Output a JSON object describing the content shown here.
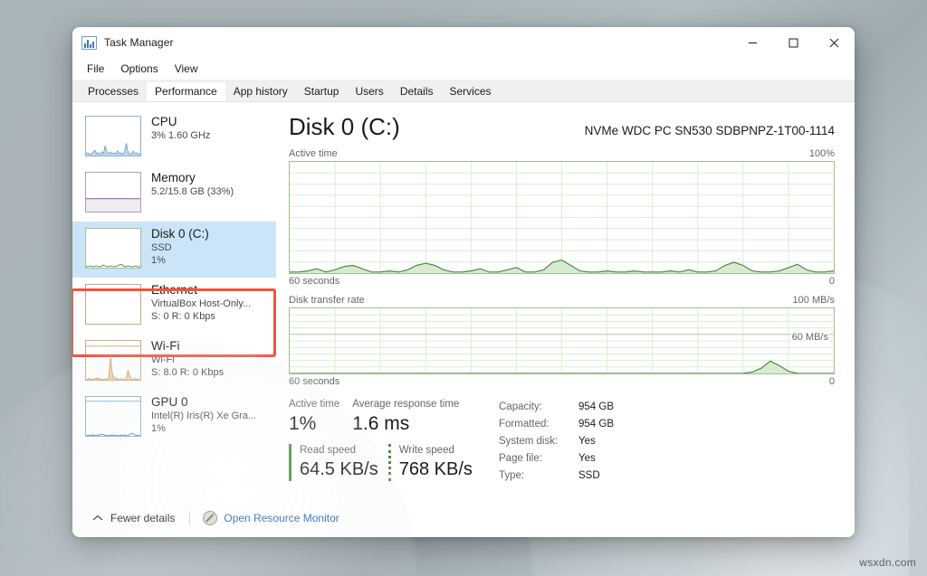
{
  "window": {
    "title": "Task Manager",
    "app_icon": "task-manager-chart-icon",
    "controls": {
      "minimize": "minimize-icon",
      "maximize": "maximize-icon",
      "close": "close-icon"
    }
  },
  "menu": {
    "items": [
      "File",
      "Options",
      "View"
    ]
  },
  "tabs": [
    {
      "label": "Processes",
      "active": false
    },
    {
      "label": "Performance",
      "active": true
    },
    {
      "label": "App history",
      "active": false
    },
    {
      "label": "Startup",
      "active": false
    },
    {
      "label": "Users",
      "active": false
    },
    {
      "label": "Details",
      "active": false
    },
    {
      "label": "Services",
      "active": false
    }
  ],
  "sidebar": {
    "items": [
      {
        "title": "CPU",
        "sub1": "3%  1.60 GHz",
        "sub2": "",
        "color": "#4a7eb5",
        "selected": false
      },
      {
        "title": "Memory",
        "sub1": "5.2/15.8 GB (33%)",
        "sub2": "",
        "color": "#9a67b5",
        "selected": false
      },
      {
        "title": "Disk 0 (C:)",
        "sub1": "SSD",
        "sub2": "1%",
        "color": "#4a8c3f",
        "selected": true
      },
      {
        "title": "Ethernet",
        "sub1": "VirtualBox Host-Only...",
        "sub2": "S: 0 R: 0 Kbps",
        "color": "#b07a3f",
        "selected": false
      },
      {
        "title": "Wi-Fi",
        "sub1": "Wi-Fi",
        "sub2": "S: 8.0 R: 0 Kbps",
        "color": "#c08a4a",
        "selected": false
      },
      {
        "title": "GPU 0",
        "sub1": "Intel(R) Iris(R) Xe Gra...",
        "sub2": "1%",
        "color": "#4a7eb5",
        "selected": false
      }
    ]
  },
  "main": {
    "title": "Disk 0 (C:)",
    "model": "NVMe WDC PC SN530 SDBPNPZ-1T00-1114",
    "charts": [
      {
        "name": "active-time",
        "label": "Active time",
        "max_label": "100%",
        "x_left_label": "60 seconds",
        "x_right_label": "0",
        "inline_label": ""
      },
      {
        "name": "disk-transfer-rate",
        "label": "Disk transfer rate",
        "max_label": "100 MB/s",
        "x_left_label": "60 seconds",
        "x_right_label": "0",
        "inline_label": "60 MB/s"
      }
    ],
    "stats": {
      "active_time_label": "Active time",
      "active_time_value": "1%",
      "response_label": "Average response time",
      "response_value": "1.6 ms",
      "read_label": "Read speed",
      "read_value": "64.5 KB/s",
      "write_label": "Write speed",
      "write_value": "768 KB/s",
      "properties": [
        {
          "key": "Capacity:",
          "value": "954 GB"
        },
        {
          "key": "Formatted:",
          "value": "954 GB"
        },
        {
          "key": "System disk:",
          "value": "Yes"
        },
        {
          "key": "Page file:",
          "value": "Yes"
        },
        {
          "key": "Type:",
          "value": "SSD"
        }
      ]
    }
  },
  "footer": {
    "fewer_details": "Fewer details",
    "open_resource_monitor": "Open Resource Monitor"
  },
  "watermark": "wsxdn.com",
  "colors": {
    "disk_accent": "#4a8c3f",
    "selection": "#cce4f7",
    "annotation": "#f4533c",
    "link": "#1a5fb4"
  },
  "chart_data": {
    "type": "area",
    "title": "Disk 0 (C:) performance",
    "charts": [
      {
        "name": "Active time",
        "ylabel": "Active time",
        "ylim": [
          0,
          100
        ],
        "yunit": "%",
        "xlabel": "60 seconds",
        "xlim": [
          60,
          0
        ],
        "grid": true,
        "grid_cols": 12,
        "grid_rows": 10,
        "series": [
          {
            "name": "Active time",
            "color": "#4a8c3f",
            "values": [
              1,
              1,
              2,
              1,
              5,
              3,
              1,
              6,
              2,
              1,
              1,
              4,
              2,
              1,
              3,
              1,
              8,
              2,
              1,
              1,
              2,
              1,
              1,
              3,
              1,
              1,
              2,
              1,
              12,
              3,
              1,
              1,
              2,
              1,
              1,
              2,
              1,
              1,
              3,
              1,
              1,
              2,
              1,
              1,
              1,
              2,
              1,
              1,
              5,
              8,
              4,
              1,
              1,
              2,
              1,
              1,
              5,
              6,
              2,
              1
            ]
          }
        ]
      },
      {
        "name": "Disk transfer rate",
        "ylabel": "Disk transfer rate",
        "ylim": [
          0,
          100
        ],
        "yunit": "MB/s",
        "inline_gridline": 60,
        "xlabel": "60 seconds",
        "xlim": [
          60,
          0
        ],
        "grid": true,
        "grid_cols": 12,
        "grid_rows": 10,
        "series": [
          {
            "name": "Disk transfer rate",
            "color": "#4a8c3f",
            "values": [
              0,
              0,
              0,
              0,
              0,
              0,
              0,
              0,
              0,
              0,
              0,
              0,
              0,
              0,
              0,
              0,
              0,
              0,
              0,
              0,
              0,
              0,
              0,
              0,
              0,
              0,
              0,
              0,
              0,
              0,
              0,
              0,
              0,
              0,
              0,
              0,
              0,
              0,
              0,
              0,
              0,
              0,
              0,
              0,
              0,
              0,
              0,
              0,
              0,
              0,
              2,
              6,
              12,
              7,
              2,
              0,
              0,
              0,
              0,
              0
            ]
          }
        ]
      }
    ],
    "mini_graphs": [
      {
        "name": "CPU",
        "color": "#4a7eb5",
        "values": [
          2,
          1,
          3,
          1,
          2,
          5,
          1,
          2,
          1,
          3,
          1,
          8,
          2,
          1,
          3,
          1,
          2,
          1,
          4,
          1,
          2,
          1,
          3,
          10,
          2,
          1,
          1,
          3,
          1,
          2
        ]
      },
      {
        "name": "Memory",
        "color": "#9a67b5",
        "values": [
          33,
          33,
          33,
          33,
          33,
          33,
          33,
          33,
          33,
          33,
          33,
          33,
          33,
          33,
          33,
          33,
          33,
          33,
          33,
          33,
          33,
          33,
          33,
          33,
          33,
          33,
          33,
          33,
          33,
          33
        ]
      },
      {
        "name": "Disk 0 (C:)",
        "color": "#4a8c3f",
        "values": [
          1,
          1,
          2,
          1,
          1,
          3,
          1,
          1,
          2,
          1,
          1,
          1,
          2,
          1,
          1,
          4,
          1,
          1,
          2,
          1,
          1,
          1,
          3,
          1,
          1,
          2,
          1,
          1,
          2,
          1
        ]
      },
      {
        "name": "Ethernet",
        "color": "#b07a3f",
        "values": [
          0,
          0,
          0,
          0,
          0,
          0,
          0,
          0,
          0,
          0,
          0,
          0,
          0,
          0,
          0,
          0,
          0,
          0,
          0,
          0,
          0,
          0,
          0,
          0,
          0,
          0,
          0,
          0,
          0,
          0
        ]
      },
      {
        "name": "Wi-Fi",
        "color": "#c08a4a",
        "values": [
          1,
          0,
          1,
          0,
          2,
          1,
          0,
          1,
          3,
          1,
          0,
          1,
          0,
          45,
          12,
          3,
          1,
          0,
          1,
          2,
          0,
          1,
          0,
          1,
          18,
          2,
          1,
          0,
          1,
          0
        ]
      },
      {
        "name": "GPU 0",
        "color": "#4a7eb5",
        "values": [
          0,
          0,
          1,
          0,
          0,
          2,
          0,
          0,
          1,
          0,
          0,
          1,
          0,
          0,
          3,
          0,
          0,
          1,
          0,
          0,
          1,
          0,
          0,
          2,
          0,
          0,
          1,
          0,
          4,
          1
        ]
      }
    ]
  }
}
